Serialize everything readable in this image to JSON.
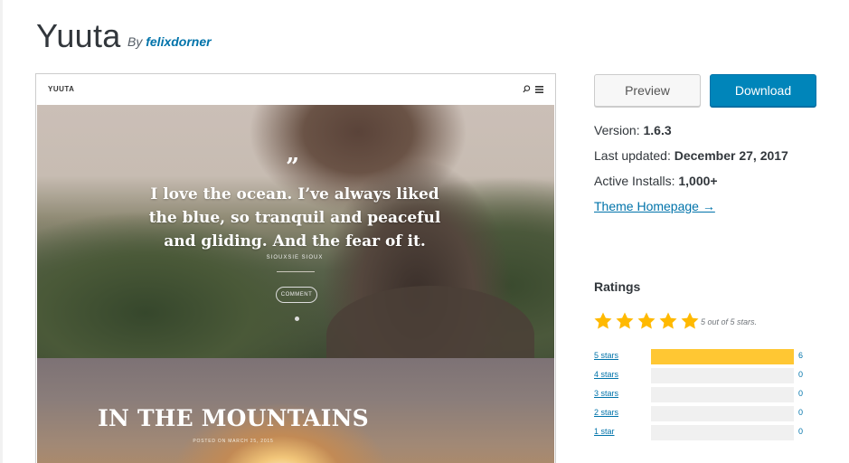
{
  "theme": {
    "name": "Yuuta",
    "by_label": "By",
    "author": "felixdorner"
  },
  "screenshot": {
    "logo": "YUUTA",
    "quote_mark": "”",
    "quote": "I love the ocean. I’ve always liked the blue, so tranquil and peaceful and gliding. And the fear of it.",
    "cite": "SIOUXSIE SIOUX",
    "button": "COMMENT",
    "post_title": "IN THE MOUNTAINS",
    "post_meta": "POSTED ON MARCH 25, 2015"
  },
  "actions": {
    "preview": "Preview",
    "download": "Download"
  },
  "meta": {
    "version_label": "Version:",
    "version": "1.6.3",
    "updated_label": "Last updated:",
    "updated": "December 27, 2017",
    "installs_label": "Active Installs:",
    "installs": "1,000+",
    "homepage": "Theme Homepage →"
  },
  "ratings": {
    "heading": "Ratings",
    "average_stars": 5,
    "summary": "5 out of 5 stars.",
    "rows": [
      {
        "label": "5 stars",
        "count": "6",
        "fraction": 1.0
      },
      {
        "label": "4 stars",
        "count": "0",
        "fraction": 0
      },
      {
        "label": "3 stars",
        "count": "0",
        "fraction": 0
      },
      {
        "label": "2 stars",
        "count": "0",
        "fraction": 0
      },
      {
        "label": "1 star",
        "count": "0",
        "fraction": 0
      }
    ]
  },
  "colors": {
    "link": "#0073aa",
    "download_button": "#0085ba",
    "star": "#ffb900",
    "bar_fill": "#ffc733",
    "bar_empty": "#f0f0f0"
  },
  "icons": {
    "search": "search-icon",
    "menu": "menu-icon",
    "star": "star-icon"
  }
}
